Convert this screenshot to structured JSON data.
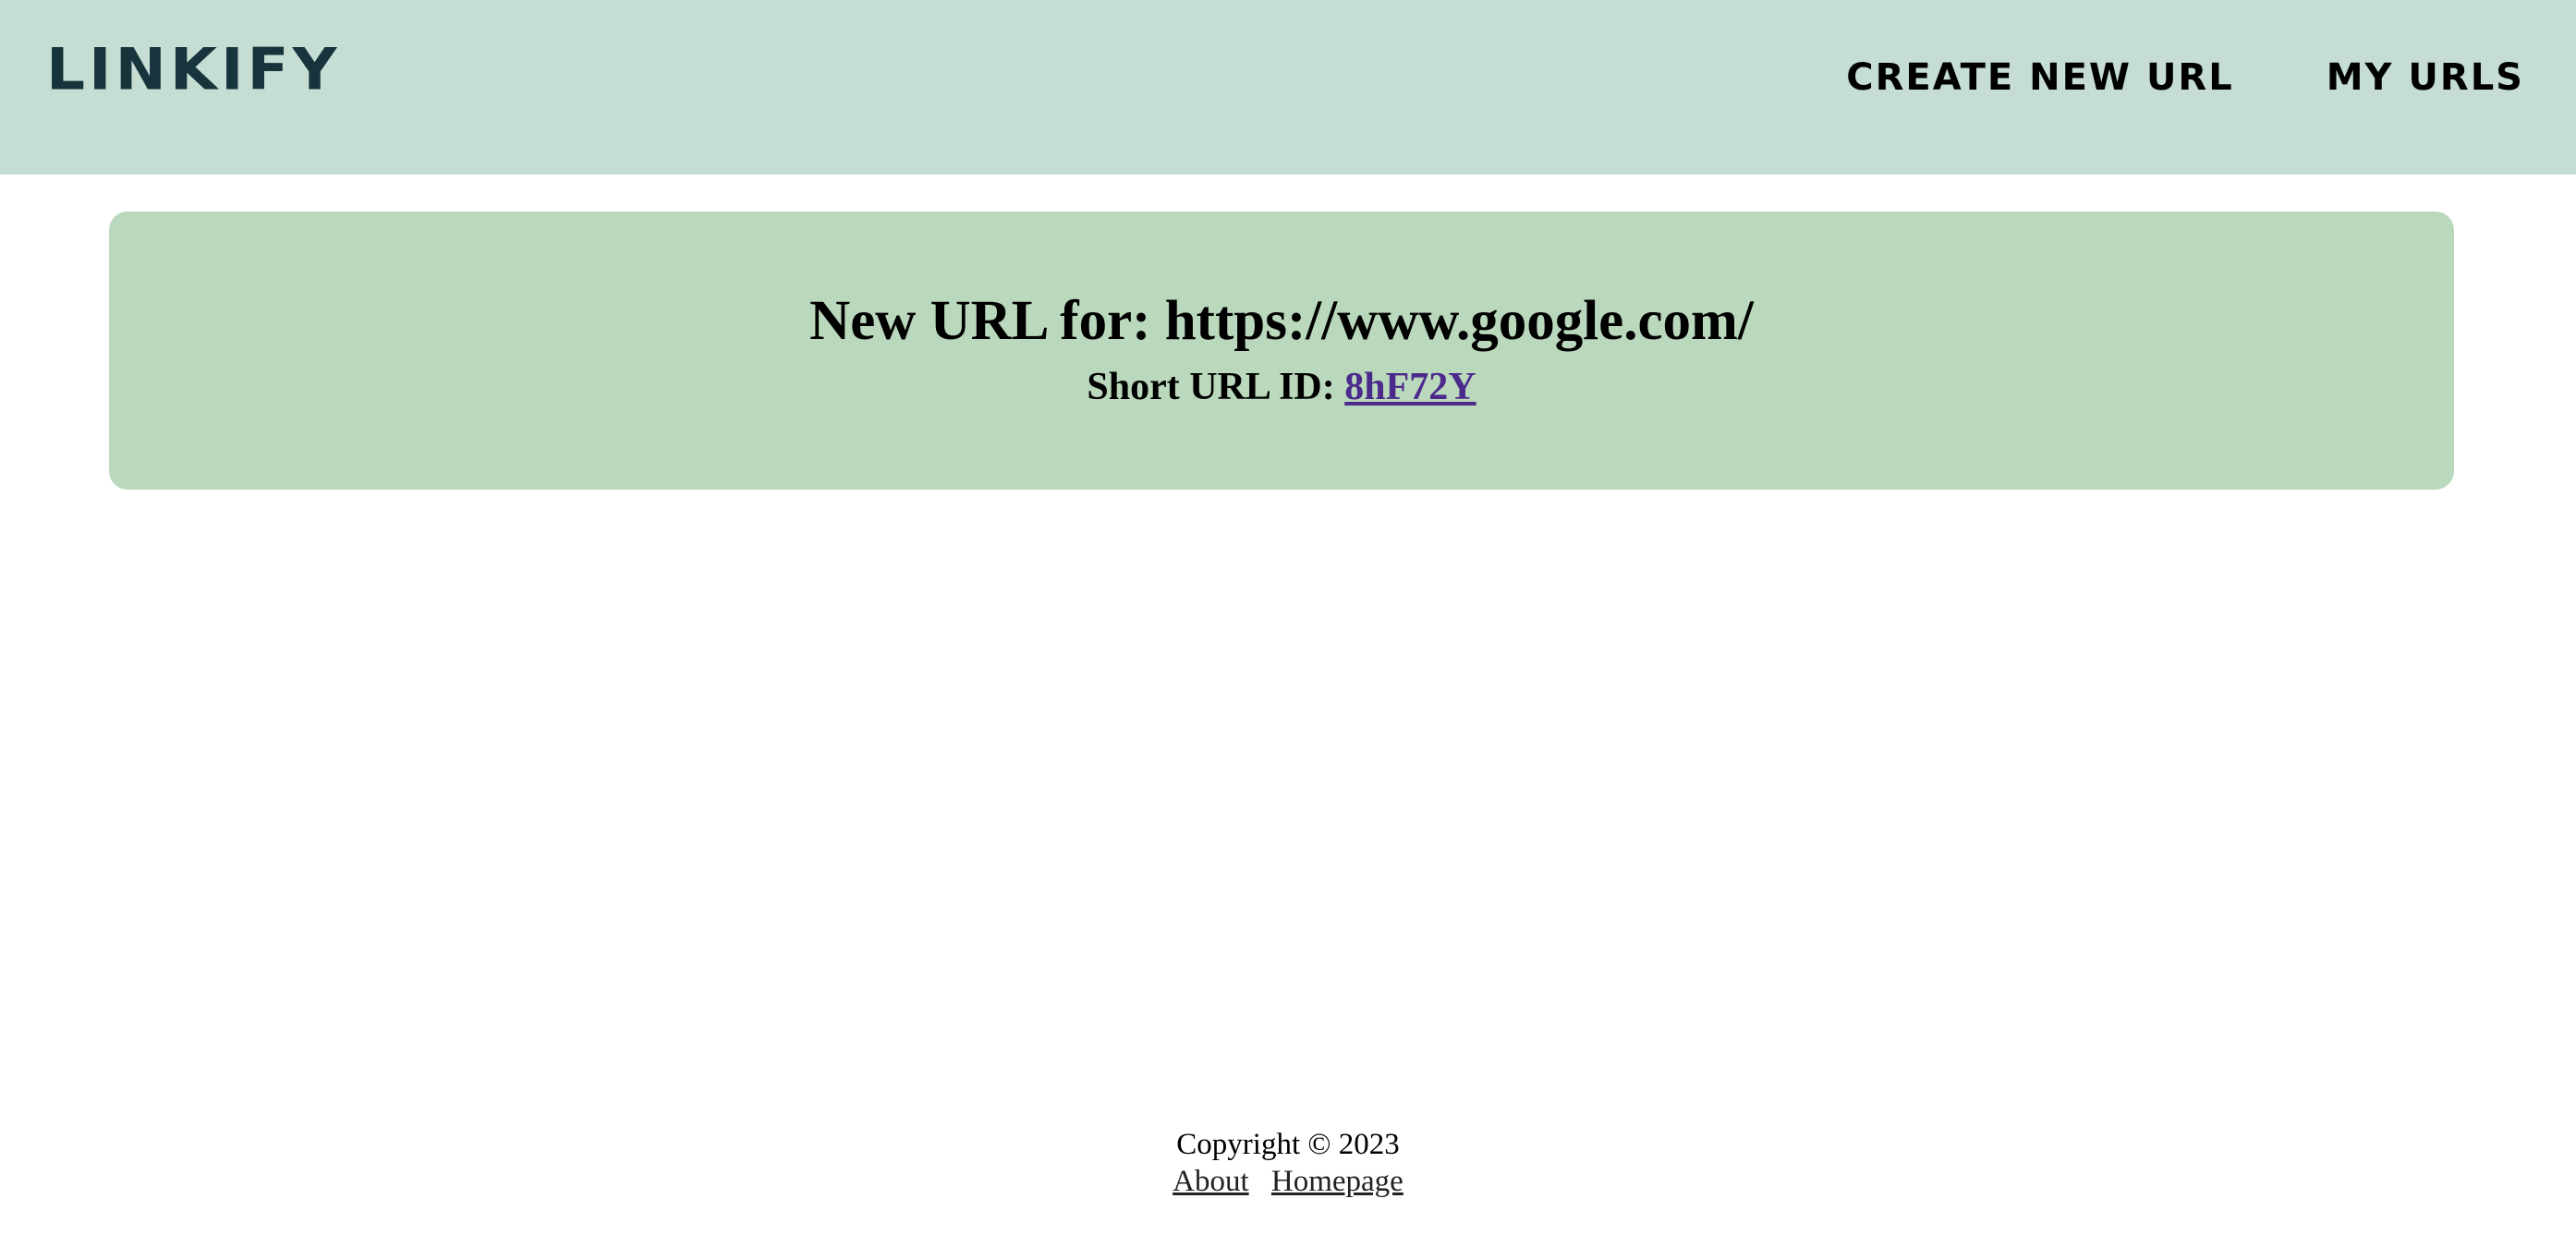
{
  "header": {
    "logo": "LINKIFY",
    "nav": {
      "create_new_url": "CREATE NEW URL",
      "my_urls": "MY URLS"
    }
  },
  "result": {
    "title": "New URL for: https://www.google.com/",
    "short_id_label": "Short URL ID:",
    "short_id_value": "8hF72Y"
  },
  "footer": {
    "copyright": "Copyright © 2023",
    "links": {
      "about": "About",
      "homepage": "Homepage"
    }
  },
  "colors": {
    "header_bg": "#c6ddd3",
    "card_bg": "#bad8bb",
    "logo_text": "#17333b",
    "link_visited": "#4b2a8c"
  }
}
